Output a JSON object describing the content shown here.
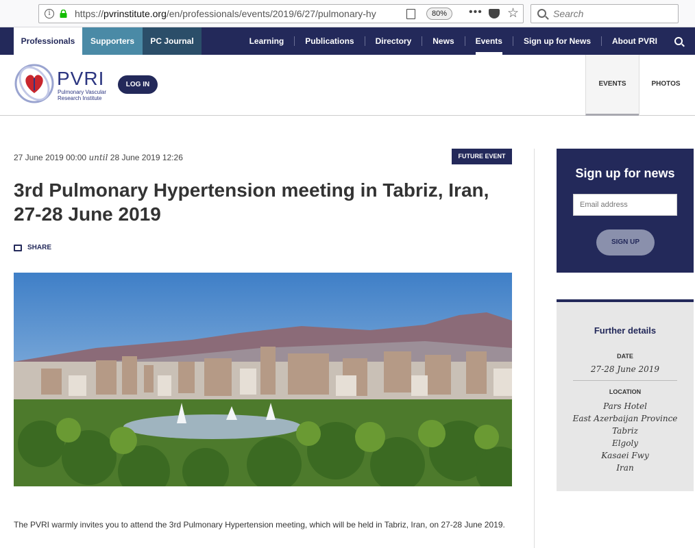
{
  "browser": {
    "url_prefix": "https://",
    "url_domain": "pvrinstitute.org",
    "url_path": "/en/professionals/events/2019/6/27/pulmonary-hy",
    "zoom": "80%",
    "search_placeholder": "Search"
  },
  "nav": {
    "tabs": [
      "Professionals",
      "Supporters",
      "PC Journal"
    ],
    "links": [
      "Learning",
      "Publications",
      "Directory",
      "News",
      "Events",
      "Sign up for News",
      "About PVRI"
    ]
  },
  "header": {
    "logo_word": "PVRI",
    "logo_sub": "Pulmonary Vascular Research Institute",
    "login_label": "LOG IN",
    "sub_tabs": [
      "EVENTS",
      "PHOTOS"
    ]
  },
  "event": {
    "start": "27 June 2019 00:00",
    "until": "until",
    "end": "28 June 2019 12:26",
    "badge": "FUTURE EVENT",
    "title": "3rd Pulmonary Hypertension meeting in Tabriz, Iran, 27-28 June 2019",
    "share_label": "SHARE",
    "body": "The PVRI warmly invites you to attend the 3rd Pulmonary Hypertension meeting, which will be held in Tabriz, Iran, on 27-28 June 2019."
  },
  "signup": {
    "title": "Sign up for news",
    "placeholder": "Email address",
    "button": "SIGN UP"
  },
  "details": {
    "title": "Further details",
    "date_label": "DATE",
    "date_value": "27-28 June 2019",
    "location_label": "LOCATION",
    "location_lines": [
      "Pars Hotel",
      "East Azerbaijan Province",
      "Tabriz",
      "Elgoly",
      "Kasaei Fwy",
      "Iran"
    ]
  },
  "colors": {
    "navy": "#23295a",
    "supporters": "#4a8aa6",
    "pcjournal": "#2b4e69"
  }
}
